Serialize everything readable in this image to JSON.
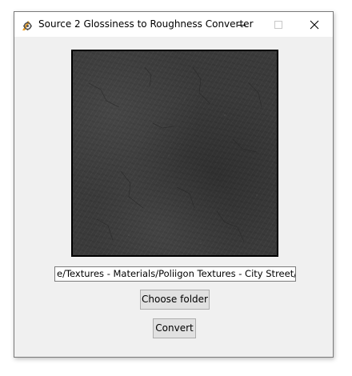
{
  "window": {
    "title": "Source 2 Glossiness to Roughness Converter",
    "app_icon": "feather-gear-icon",
    "controls": {
      "minimize_icon": "minimize-icon",
      "maximize_icon": "maximize-icon",
      "close_icon": "close-icon"
    }
  },
  "preview": {
    "description_icon": "texture-preview-image"
  },
  "path_field": {
    "value": "e/Textures - Materials/Poliigon Textures - City Street/City"
  },
  "buttons": {
    "choose_folder": "Choose folder",
    "convert": "Convert"
  },
  "colors": {
    "window_bg": "#f0f0f0",
    "titlebar_bg": "#ffffff",
    "button_bg": "#e1e1e1",
    "button_border": "#adadad",
    "preview_border": "#000000",
    "texture_base": "#3b3b3b",
    "icon_orange": "#f0a020"
  }
}
